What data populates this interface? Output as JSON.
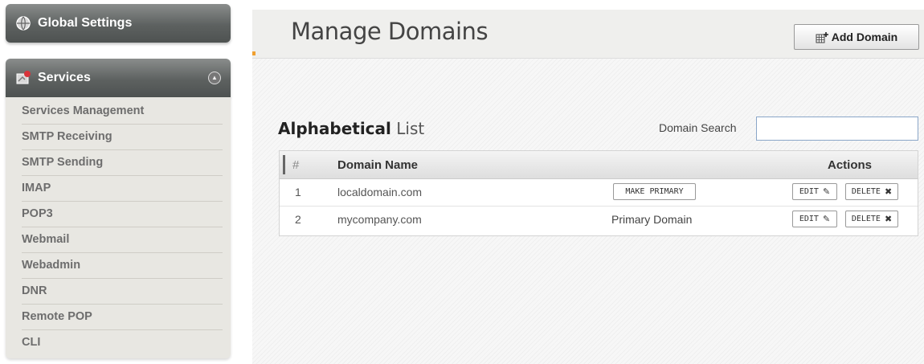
{
  "sidebar": {
    "global_settings": "Global Settings",
    "services": "Services",
    "items": [
      {
        "label": "Services Management"
      },
      {
        "label": "SMTP Receiving"
      },
      {
        "label": "SMTP Sending"
      },
      {
        "label": "IMAP"
      },
      {
        "label": "POP3"
      },
      {
        "label": "Webmail"
      },
      {
        "label": "Webadmin"
      },
      {
        "label": "DNR"
      },
      {
        "label": "Remote POP"
      },
      {
        "label": "CLI"
      }
    ]
  },
  "header": {
    "title": "Manage Domains",
    "add_button": "Add Domain"
  },
  "list": {
    "title_bold": "Alphabetical",
    "title_light": "List",
    "search_label": "Domain Search",
    "search_value": ""
  },
  "table": {
    "headers": {
      "num": "#",
      "name": "Domain Name",
      "actions": "Actions"
    },
    "rows": [
      {
        "num": "1",
        "name": "localdomain.com",
        "status": "MAKE PRIMARY",
        "edit": "EDIT",
        "delete": "DELETE"
      },
      {
        "num": "2",
        "name": "mycompany.com",
        "status": "Primary Domain",
        "edit": "EDIT",
        "delete": "DELETE"
      }
    ]
  }
}
